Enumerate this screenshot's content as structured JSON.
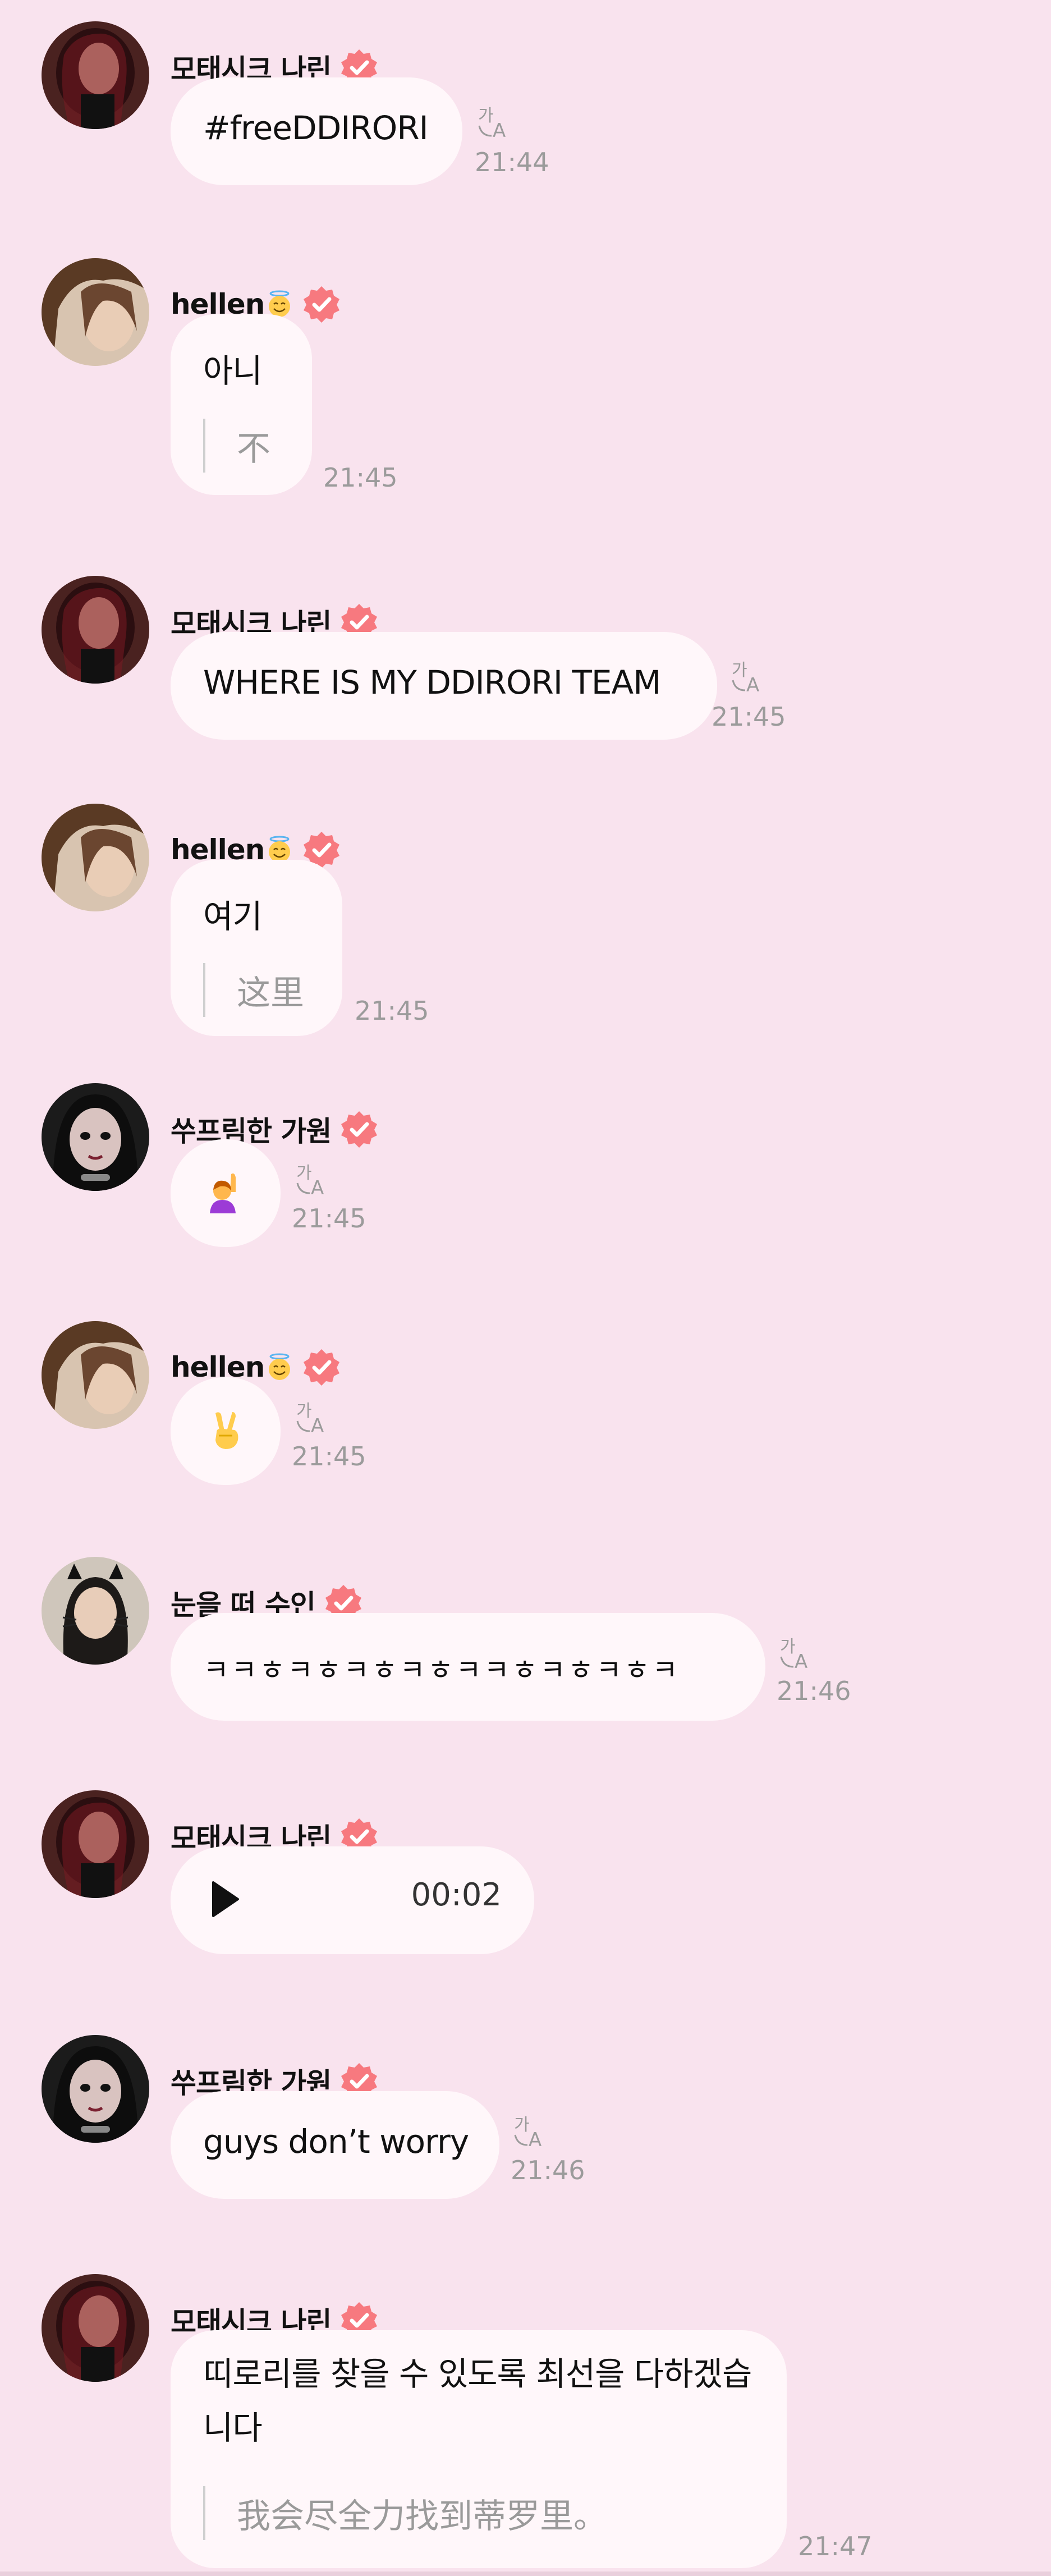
{
  "colors": {
    "background": "#f9e3ee",
    "bubble": "#fff7fa",
    "verified": "#f7797f",
    "timestamp": "#9b9b9b",
    "translation_text": "#9a9a9a"
  },
  "messages": [
    {
      "sender": "모태시크 나린",
      "text": "#freeDDIRORI",
      "time": "21:44",
      "has_translate_icon": true,
      "avatar": "avatar-narin"
    },
    {
      "sender": "hellen",
      "sender_emoji": "smiling-face-with-halo-emoji",
      "text": "아니",
      "translation": "不",
      "time": "21:45",
      "avatar": "avatar-hellen"
    },
    {
      "sender": "모태시크 나린",
      "text": "WHERE IS MY DDIRORI TEAM",
      "time": "21:45",
      "has_translate_icon": true,
      "avatar": "avatar-narin"
    },
    {
      "sender": "hellen",
      "sender_emoji": "smiling-face-with-halo-emoji",
      "text": "여기",
      "translation": "这里",
      "time": "21:45",
      "avatar": "avatar-hellen"
    },
    {
      "sender": "쑤프림한 가원",
      "content_emoji": "person-raising-hand-emoji",
      "time": "21:45",
      "has_translate_icon": true,
      "avatar": "avatar-gawon"
    },
    {
      "sender": "hellen",
      "sender_emoji": "smiling-face-with-halo-emoji",
      "content_emoji": "victory-hand-emoji",
      "time": "21:45",
      "has_translate_icon": true,
      "avatar": "avatar-hellen"
    },
    {
      "sender": "눈을 떠 수인",
      "text": "ㅋㅋㅎㅋㅎㅋㅎㅋㅎㅋㅋㅎㅋㅎㅋㅎㅋ",
      "time": "21:46",
      "has_translate_icon": true,
      "avatar": "avatar-suin"
    },
    {
      "sender": "모태시크 나린",
      "voice_duration": "00:02",
      "avatar": "avatar-narin"
    },
    {
      "sender": "쑤프림한 가원",
      "text": "guys don’t worry",
      "time": "21:46",
      "has_translate_icon": true,
      "avatar": "avatar-gawon"
    },
    {
      "sender": "모태시크 나린",
      "text": "띠로리를 찾을 수 있도록 최선을 다하겠습니다",
      "translation": "我会尽全力找到蒂罗里。",
      "time": "21:47",
      "avatar": "avatar-narin"
    }
  ]
}
